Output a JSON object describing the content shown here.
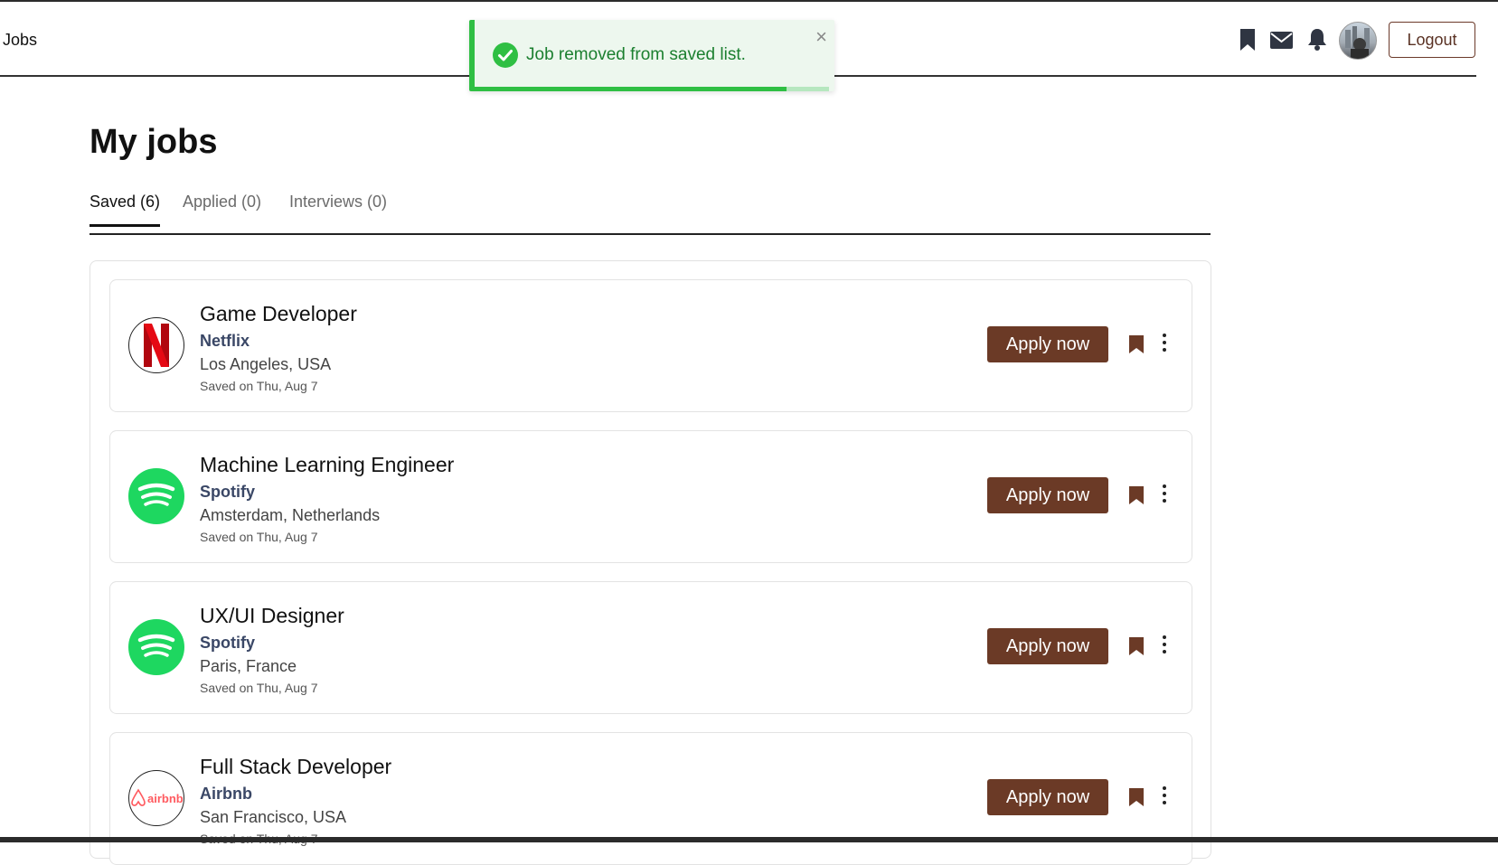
{
  "navbar": {
    "brand": "Jobs",
    "icons": [
      "bookmark-icon",
      "envelope-icon",
      "bell-icon"
    ],
    "logout_label": "Logout"
  },
  "toast": {
    "message": "Job removed from saved list.",
    "close_glyph": "×",
    "status_color": "#2fbf43",
    "progress_remaining": 0.88
  },
  "page": {
    "title": "My jobs",
    "tabs": [
      {
        "label": "Saved (6)",
        "active": true
      },
      {
        "label": "Applied (0)",
        "active": false
      },
      {
        "label": "Interviews (0)",
        "active": false
      }
    ]
  },
  "jobs": [
    {
      "title": "Game Developer",
      "company": "Netflix",
      "location": "Los Angeles, USA",
      "saved": "Saved on Thu, Aug 7",
      "logo": "netflix-logo",
      "apply_label": "Apply now"
    },
    {
      "title": "Machine Learning Engineer",
      "company": "Spotify",
      "location": "Amsterdam, Netherlands",
      "saved": "Saved on Thu, Aug 7",
      "logo": "spotify-logo",
      "apply_label": "Apply now"
    },
    {
      "title": "UX/UI Designer",
      "company": "Spotify",
      "location": "Paris, France",
      "saved": "Saved on Thu, Aug 7",
      "logo": "spotify-logo",
      "apply_label": "Apply now"
    },
    {
      "title": "Full Stack Developer",
      "company": "Airbnb",
      "location": "San Francisco, USA",
      "saved": "Saved on Thu, Aug 7",
      "logo": "airbnb-logo",
      "logo_text": "airbnb",
      "apply_label": "Apply now"
    }
  ],
  "colors": {
    "accent_brown": "#6b3a26",
    "toast_green": "#2fbf43",
    "company_text": "#3a4766"
  }
}
